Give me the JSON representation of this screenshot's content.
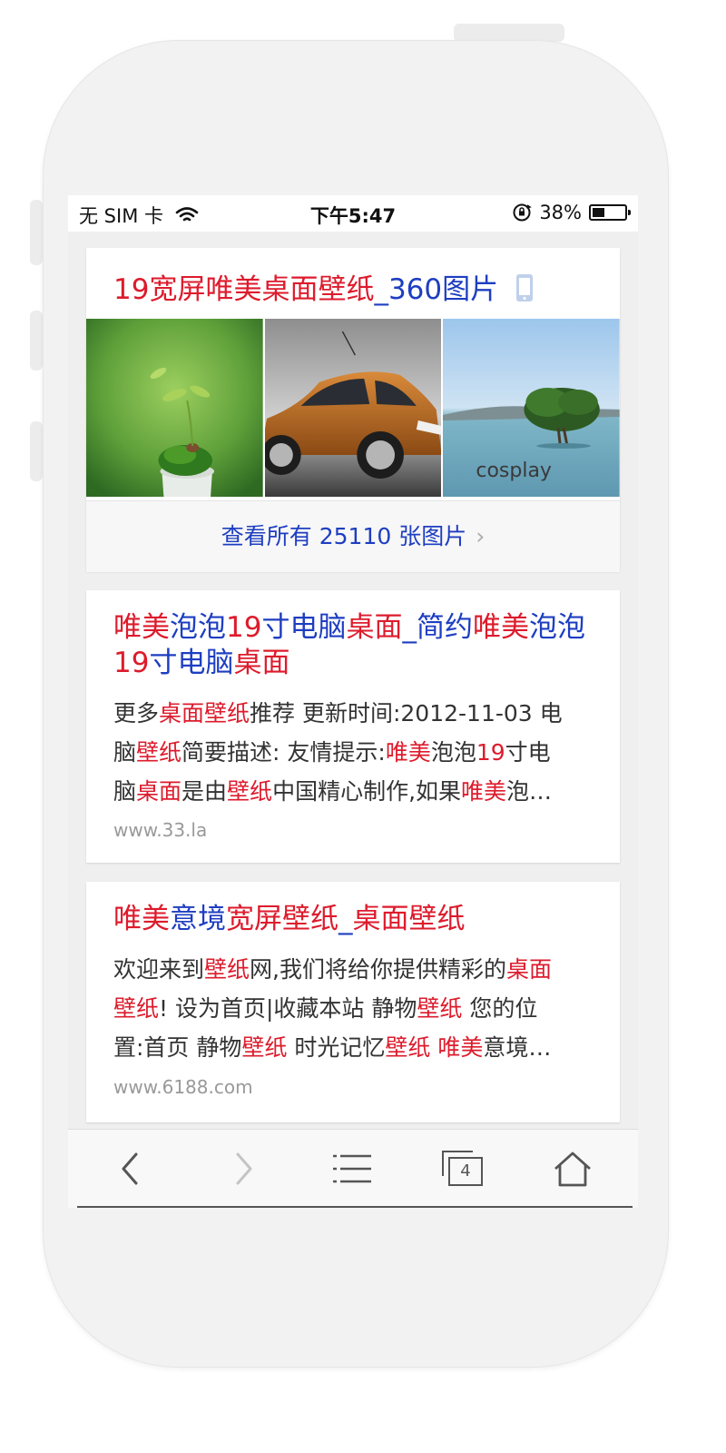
{
  "status": {
    "carrier": "无 SIM 卡",
    "time": "下午5:47",
    "battery": "38%",
    "battery_level": 0.38
  },
  "image_card": {
    "title_parts": [
      {
        "text": "19宽屏唯美桌面壁纸",
        "hl": true
      },
      {
        "text": "_360图片",
        "hl": false
      }
    ],
    "thumb_caption": "cosplay",
    "view_all": "查看所有 25110 张图片"
  },
  "results": [
    {
      "title_parts": [
        {
          "text": "唯美",
          "hl": true
        },
        {
          "text": "泡泡",
          "hl": false
        },
        {
          "text": "19",
          "hl": true
        },
        {
          "text": "寸电脑",
          "hl": false
        },
        {
          "text": "桌面",
          "hl": true
        },
        {
          "text": "_简约",
          "hl": false
        },
        {
          "text": "唯美",
          "hl": true
        },
        {
          "text": "泡泡",
          "hl": false
        },
        {
          "text": "19",
          "hl": true
        },
        {
          "text": "寸电脑",
          "hl": false
        },
        {
          "text": "桌面",
          "hl": true
        }
      ],
      "body_lines": [
        [
          {
            "text": "更多",
            "hl": false
          },
          {
            "text": "桌面壁纸",
            "hl": true
          },
          {
            "text": "推荐 更新时间:2012-11-03 电",
            "hl": false
          }
        ],
        [
          {
            "text": "脑",
            "hl": false
          },
          {
            "text": "壁纸",
            "hl": true
          },
          {
            "text": "简要描述: 友情提示:",
            "hl": false
          },
          {
            "text": "唯美",
            "hl": true
          },
          {
            "text": "泡泡",
            "hl": false
          },
          {
            "text": "19",
            "hl": true
          },
          {
            "text": "寸电",
            "hl": false
          }
        ],
        [
          {
            "text": "脑",
            "hl": false
          },
          {
            "text": "桌面",
            "hl": true
          },
          {
            "text": "是由",
            "hl": false
          },
          {
            "text": "壁纸",
            "hl": true
          },
          {
            "text": "中国精心制作,如果",
            "hl": false
          },
          {
            "text": "唯美",
            "hl": true
          },
          {
            "text": "泡…",
            "hl": false
          }
        ]
      ],
      "url": "www.33.la"
    },
    {
      "title_parts": [
        {
          "text": "唯美",
          "hl": true
        },
        {
          "text": "意境",
          "hl": false
        },
        {
          "text": "宽屏壁纸",
          "hl": true
        },
        {
          "text": "_",
          "hl": false
        },
        {
          "text": "桌面壁纸",
          "hl": true
        }
      ],
      "body_lines": [
        [
          {
            "text": "欢迎来到",
            "hl": false
          },
          {
            "text": "壁纸",
            "hl": true
          },
          {
            "text": "网,我们将给你提供精彩的",
            "hl": false
          },
          {
            "text": "桌面",
            "hl": true
          }
        ],
        [
          {
            "text": "壁纸",
            "hl": true
          },
          {
            "text": "! 设为首页|收藏本站 静物",
            "hl": false
          },
          {
            "text": "壁纸",
            "hl": true
          },
          {
            "text": " 您的位",
            "hl": false
          }
        ],
        [
          {
            "text": "置:首页 静物",
            "hl": false
          },
          {
            "text": "壁纸",
            "hl": true
          },
          {
            "text": " 时光记忆",
            "hl": false
          },
          {
            "text": "壁纸",
            "hl": true
          },
          {
            "text": " ",
            "hl": false
          },
          {
            "text": "唯美",
            "hl": true
          },
          {
            "text": "意境…",
            "hl": false
          }
        ]
      ],
      "url": "www.6188.com"
    }
  ],
  "toolbar": {
    "tab_count": "4",
    "icons": [
      "back-icon",
      "forward-icon",
      "menu-list-icon",
      "tabs-icon",
      "home-icon"
    ]
  },
  "colors": {
    "highlight": "#dd1b2c",
    "link": "#1e3ec1",
    "url": "#999999"
  }
}
